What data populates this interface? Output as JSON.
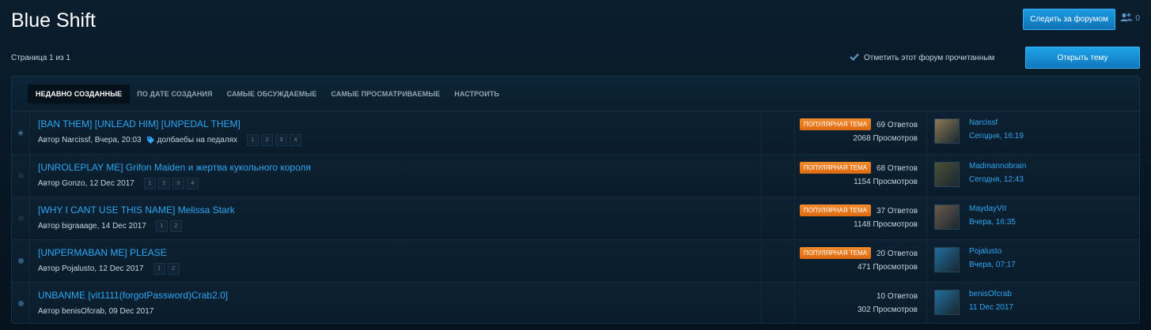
{
  "header": {
    "title": "Blue Shift",
    "follow_label": "Следить за форумом",
    "followers_count": "0"
  },
  "toolbar": {
    "page_info": "Страница 1 из 1",
    "mark_read_label": "Отметить этот форум прочитанным",
    "open_topic_label": "Открыть тему"
  },
  "tabs": [
    {
      "label": "НЕДАВНО СОЗДАННЫЕ",
      "active": true
    },
    {
      "label": "ПО ДАТЕ СОЗДАНИЯ",
      "active": false
    },
    {
      "label": "САМЫЕ ОБСУЖДАЕМЫЕ",
      "active": false
    },
    {
      "label": "САМЫЕ ПРОСМАТРИВАЕМЫЕ",
      "active": false
    },
    {
      "label": "НАСТРОИТЬ",
      "active": false
    }
  ],
  "colors": {
    "accent": "#2fa6f2",
    "popular_badge": "#e8791e",
    "background": "#081a28"
  },
  "topics": [
    {
      "marker": "star",
      "title": "[BAN THEM] [UNLEAD HIM] [UNPEDAL THEM]",
      "meta": "Автор Narcissf, Вчера, 20:03",
      "tag": "долбаебы на педалях",
      "pages": [
        "1",
        "2",
        "3",
        "4"
      ],
      "popular": "ПОПУЛЯРНАЯ ТЕМА",
      "replies": "69 Ответов",
      "views": "2068 Просмотров",
      "last_user": "Narcissf",
      "last_date": "Сегодня, 16:19",
      "avatar_color": "#8a7a55"
    },
    {
      "marker": "dim-dot",
      "title": "[UNROLEPLAY ME] Grifon Maiden и жертва кукольного короля",
      "meta": "Автор Gonzo, 12 Dec 2017",
      "tag": "",
      "pages": [
        "1",
        "2",
        "3",
        "4"
      ],
      "popular": "ПОПУЛЯРНАЯ ТЕМА",
      "replies": "68 Ответов",
      "views": "1154 Просмотров",
      "last_user": "Madmannobrain",
      "last_date": "Сегодня, 12:43",
      "avatar_color": "#4a5134"
    },
    {
      "marker": "dim-dot",
      "title": "[WHY I CANT USE THIS NAME] Melissa Stark",
      "meta": "Автор bigraaage, 14 Dec 2017",
      "tag": "",
      "pages": [
        "1",
        "2"
      ],
      "popular": "ПОПУЛЯРНАЯ ТЕМА",
      "replies": "37 Ответов",
      "views": "1148 Просмотров",
      "last_user": "MaydayVII",
      "last_date": "Вчера, 16:35",
      "avatar_color": "#6b5a4c"
    },
    {
      "marker": "dot",
      "title": "[UNPERMABAN ME] PLEASE",
      "meta": "Автор Pojalusto, 12 Dec 2017",
      "tag": "",
      "pages": [
        "1",
        "2"
      ],
      "popular": "ПОПУЛЯРНАЯ ТЕМА",
      "replies": "20 Ответов",
      "views": "471 Просмотров",
      "last_user": "Pojalusto",
      "last_date": "Вчера, 07:17",
      "avatar_color": "#1f6f9e"
    },
    {
      "marker": "dot",
      "title": "UNBANME [vit1111(forgotPassword)Crab2.0]",
      "meta": "Автор benisOfcrab, 09 Dec 2017",
      "tag": "",
      "pages": [],
      "popular": "",
      "replies": "10 Ответов",
      "views": "302 Просмотров",
      "last_user": "benisOfcrab",
      "last_date": "11 Dec 2017",
      "avatar_color": "#1f6f9e"
    }
  ]
}
